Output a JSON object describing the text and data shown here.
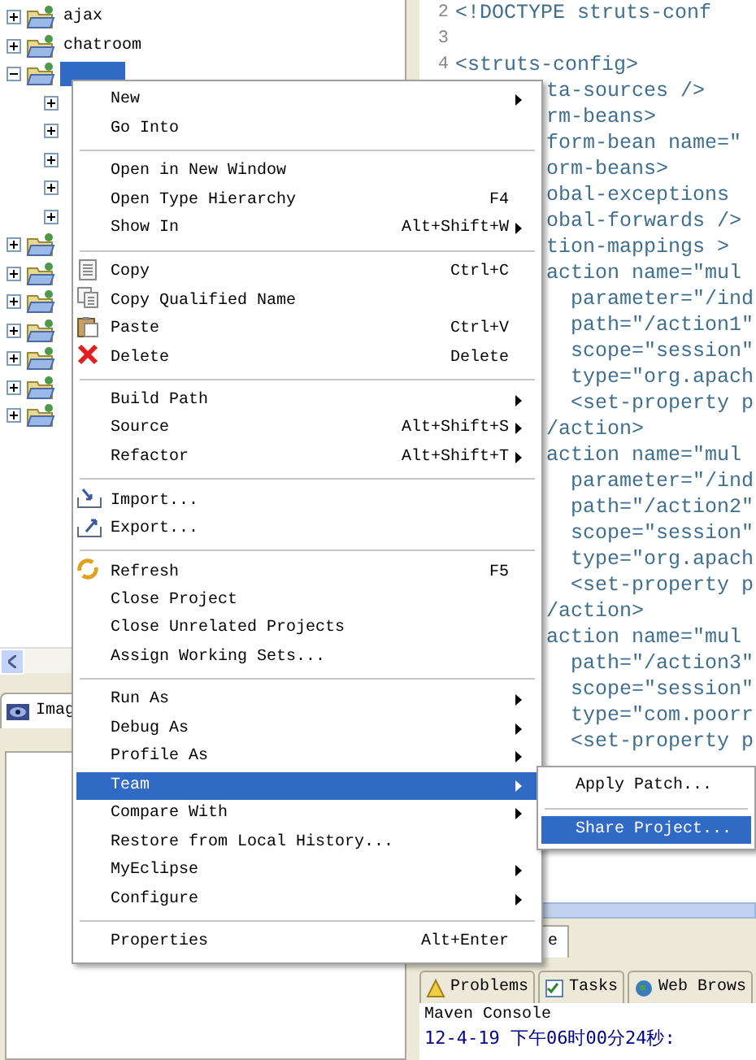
{
  "explorer": {
    "items": [
      {
        "label": "ajax",
        "expanded": false,
        "selected": false
      },
      {
        "label": "chatroom",
        "expanded": false,
        "selected": false
      },
      {
        "expanded": true,
        "selected": true,
        "children": [
          {
            "expanded": false
          },
          {
            "expanded": false
          },
          {
            "expanded": false
          },
          {
            "expanded": false
          },
          {
            "expanded": false
          }
        ]
      },
      {
        "expanded": false,
        "selected": false
      },
      {
        "expanded": false,
        "selected": false
      },
      {
        "expanded": false,
        "selected": false
      },
      {
        "expanded": false,
        "selected": false
      },
      {
        "expanded": false,
        "selected": false
      },
      {
        "expanded": false,
        "selected": false
      },
      {
        "expanded": false,
        "selected": false
      }
    ]
  },
  "image_view": {
    "tab": "Imag"
  },
  "editor": {
    "lines": [
      {
        "number": "2",
        "text": "<!DOCTYPE struts-conf"
      },
      {
        "number": "3"
      },
      {
        "number": "4",
        "text": "<struts-config>"
      },
      {
        "text": "ta-sources />"
      },
      {
        "text": "rm-beans>"
      },
      {
        "text": "form-bean name=\""
      },
      {
        "text": "orm-beans>"
      },
      {
        "text": "obal-exceptions"
      },
      {
        "text": "obal-forwards />"
      },
      {
        "text": "tion-mappings >"
      },
      {
        "text": "action name=\"mul"
      },
      {
        "text": "  parameter=\"/ind"
      },
      {
        "text": "  path=\"/action1\""
      },
      {
        "text": "  scope=\"session\""
      },
      {
        "text": "  type=\"org.apach"
      },
      {
        "text": "  <set-property p"
      },
      {
        "text": "/action>"
      },
      {
        "text": "action name=\"mul"
      },
      {
        "text": "  parameter=\"/ind"
      },
      {
        "text": "  path=\"/action2\""
      },
      {
        "text": "  scope=\"session\""
      },
      {
        "text": "  type=\"org.apach"
      },
      {
        "text": "  <set-property p"
      },
      {
        "text": "/action>"
      },
      {
        "text": "action name=\"mul"
      },
      {
        "text": "  path=\"/action3\""
      },
      {
        "text": "  scope=\"session\""
      },
      {
        "text": "  type=\"com.poorr"
      },
      {
        "text": "  <set-property p"
      }
    ],
    "view_tab": "e"
  },
  "bottom_tabs": [
    {
      "label": "Problems",
      "kind": "warning",
      "selected": false
    },
    {
      "label": "Tasks",
      "kind": "tasks",
      "selected": false
    },
    {
      "label": "Web Brows",
      "kind": "globe",
      "selected": false
    }
  ],
  "console": {
    "title": "Maven Console",
    "line": "12-4-19 下午06时00分24秒:"
  },
  "context_menu": {
    "groups": [
      [
        {
          "label": "New",
          "submenu": true,
          "selected": false
        },
        {
          "label": "Go Into",
          "selected": false
        }
      ],
      [
        {
          "label": "Open in New Window",
          "selected": false
        },
        {
          "label": "Open Type Hierarchy",
          "shortcut": "F4",
          "selected": false
        },
        {
          "label": "Show In",
          "shortcut": "Alt+Shift+W",
          "submenu": true,
          "selected": false
        }
      ],
      [
        {
          "label": "Copy",
          "kind": "copy",
          "shortcut": "Ctrl+C",
          "selected": false
        },
        {
          "label": "Copy Qualified Name",
          "kind": "copy-name",
          "selected": false
        },
        {
          "label": "Paste",
          "kind": "paste",
          "shortcut": "Ctrl+V",
          "selected": false
        },
        {
          "label": "Delete",
          "kind": "delete",
          "shortcut": "Delete",
          "selected": false
        }
      ],
      [
        {
          "label": "Build Path",
          "submenu": true,
          "selected": false
        },
        {
          "label": "Source",
          "shortcut": "Alt+Shift+S",
          "submenu": true,
          "selected": false
        },
        {
          "label": "Refactor",
          "shortcut": "Alt+Shift+T",
          "submenu": true,
          "selected": false
        }
      ],
      [
        {
          "label": "Import...",
          "kind": "import",
          "selected": false
        },
        {
          "label": "Export...",
          "kind": "export",
          "selected": false
        }
      ],
      [
        {
          "label": "Refresh",
          "kind": "refresh",
          "shortcut": "F5",
          "selected": false
        },
        {
          "label": "Close Project",
          "selected": false
        },
        {
          "label": "Close Unrelated Projects",
          "selected": false
        },
        {
          "label": "Assign Working Sets...",
          "selected": false
        }
      ],
      [
        {
          "label": "Run As",
          "submenu": true,
          "selected": false
        },
        {
          "label": "Debug As",
          "submenu": true,
          "selected": false
        },
        {
          "label": "Profile As",
          "submenu": true,
          "selected": false
        },
        {
          "label": "Team",
          "submenu": true,
          "selected": true
        },
        {
          "label": "Compare With",
          "submenu": true,
          "selected": false
        },
        {
          "label": "Restore from Local History...",
          "selected": false
        },
        {
          "label": "MyEclipse",
          "submenu": true,
          "selected": false
        },
        {
          "label": "Configure",
          "submenu": true,
          "selected": false
        }
      ],
      [
        {
          "label": "Properties",
          "shortcut": "Alt+Enter",
          "selected": false
        }
      ]
    ]
  },
  "submenu": {
    "groups": [
      [
        {
          "label": "Apply Patch...",
          "selected": false
        }
      ],
      [
        {
          "label": "Share Project...",
          "selected": true
        }
      ]
    ]
  }
}
